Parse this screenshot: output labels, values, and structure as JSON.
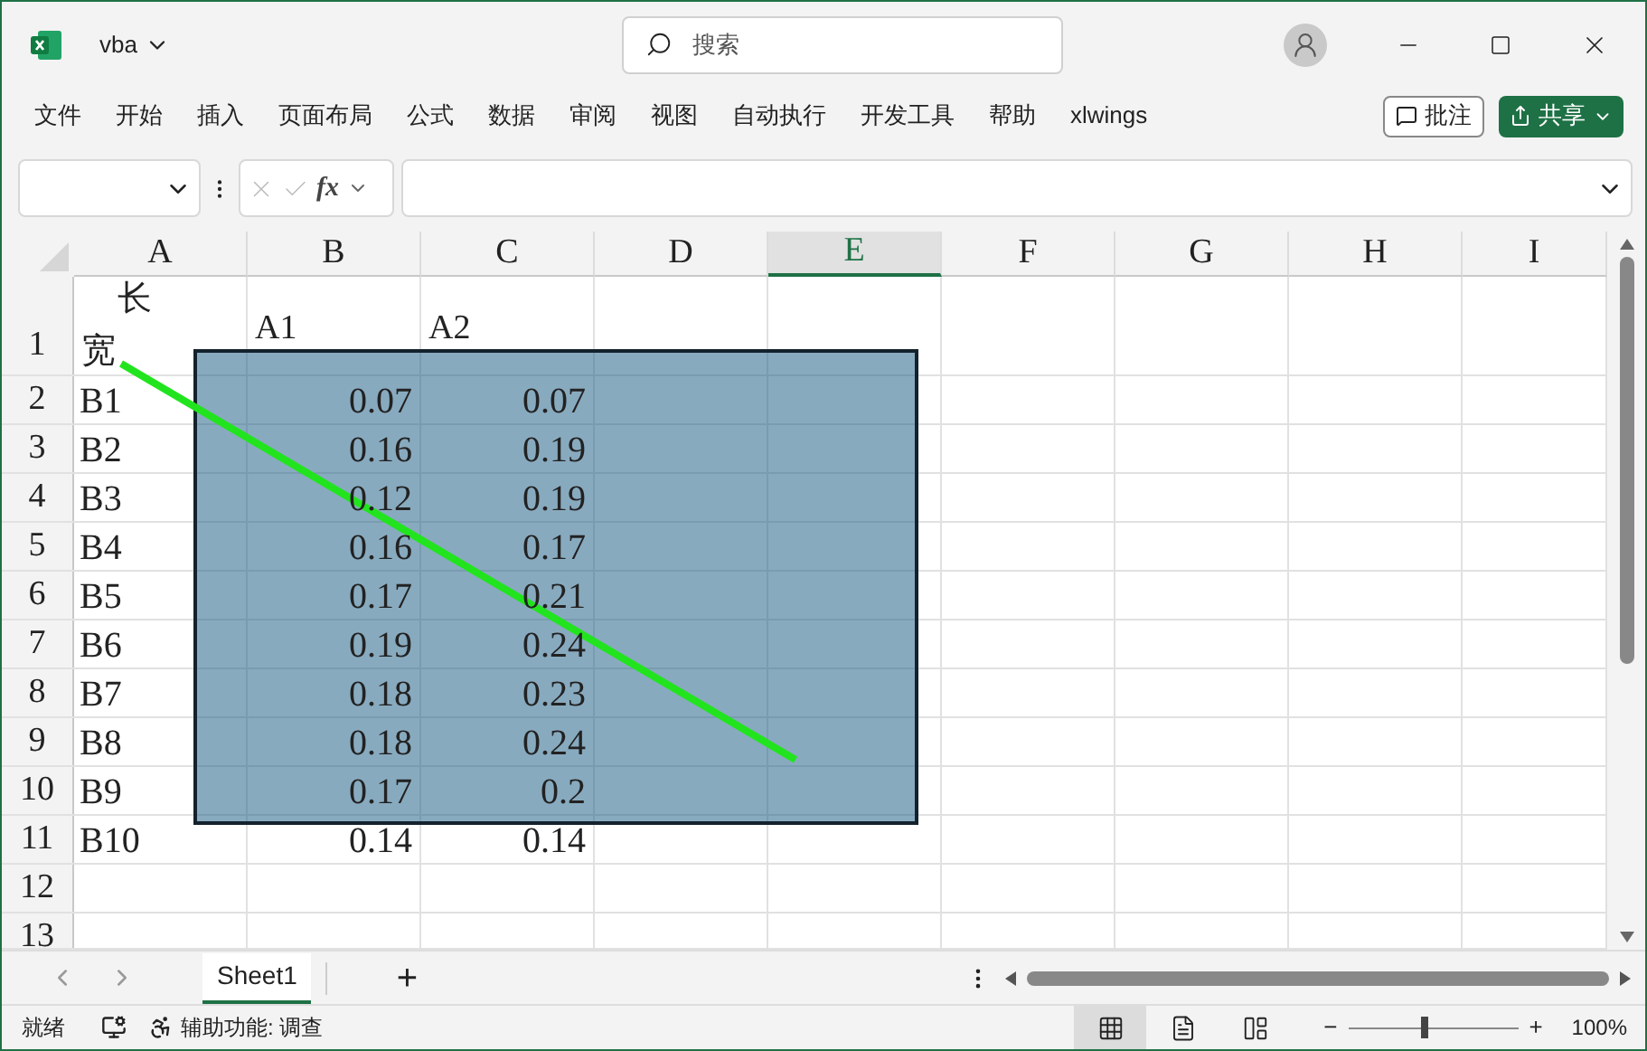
{
  "title_bar": {
    "file_name": "vba",
    "search": {
      "placeholder": "搜索"
    }
  },
  "ribbon_tabs": [
    "文件",
    "开始",
    "插入",
    "页面布局",
    "公式",
    "数据",
    "审阅",
    "视图",
    "自动执行",
    "开发工具",
    "帮助",
    "xlwings"
  ],
  "comment_button": "批注",
  "share_button": "共享",
  "formula_bar": {
    "function_label": "fx"
  },
  "sheet": {
    "columns": [
      {
        "label": "A",
        "selected": false
      },
      {
        "label": "B",
        "selected": false
      },
      {
        "label": "C",
        "selected": false
      },
      {
        "label": "D",
        "selected": false
      },
      {
        "label": "E",
        "selected": true
      },
      {
        "label": "F",
        "selected": false
      },
      {
        "label": "G",
        "selected": false
      },
      {
        "label": "H",
        "selected": false
      },
      {
        "label": "I",
        "selected": false
      }
    ],
    "header_row": {
      "number": "1",
      "corner_top": "长",
      "corner_bottom": "宽",
      "cells": [
        "A1",
        "A2"
      ]
    },
    "rows": [
      {
        "number": "2",
        "cells": [
          "B1",
          "0.07",
          "0.07"
        ]
      },
      {
        "number": "3",
        "cells": [
          "B2",
          "0.16",
          "0.19"
        ]
      },
      {
        "number": "4",
        "cells": [
          "B3",
          "0.12",
          "0.19"
        ]
      },
      {
        "number": "5",
        "cells": [
          "B4",
          "0.16",
          "0.17"
        ]
      },
      {
        "number": "6",
        "cells": [
          "B5",
          "0.17",
          "0.21"
        ]
      },
      {
        "number": "7",
        "cells": [
          "B6",
          "0.19",
          "0.24"
        ]
      },
      {
        "number": "8",
        "cells": [
          "B7",
          "0.18",
          "0.23"
        ]
      },
      {
        "number": "9",
        "cells": [
          "B8",
          "0.18",
          "0.24"
        ]
      },
      {
        "number": "10",
        "cells": [
          "B9",
          "0.17",
          "0.2"
        ]
      },
      {
        "number": "11",
        "cells": [
          "B10",
          "0.14",
          "0.14"
        ]
      },
      {
        "number": "12",
        "cells": []
      },
      {
        "number": "13",
        "cells": []
      }
    ]
  },
  "sheet_tabs": [
    {
      "label": "Sheet1",
      "selected": true
    }
  ],
  "add_sheet": "+",
  "status_bar": {
    "ready": "就绪",
    "accessibility": "辅助功能: 调查",
    "views": [
      {
        "kind": "normal",
        "selected": true
      },
      {
        "kind": "page_layout",
        "selected": false
      },
      {
        "kind": "page_break",
        "selected": false
      }
    ],
    "zoom": {
      "level": 0.45
    },
    "zoom_text": "100%",
    "zoom_out": "−",
    "zoom_in": "+"
  }
}
